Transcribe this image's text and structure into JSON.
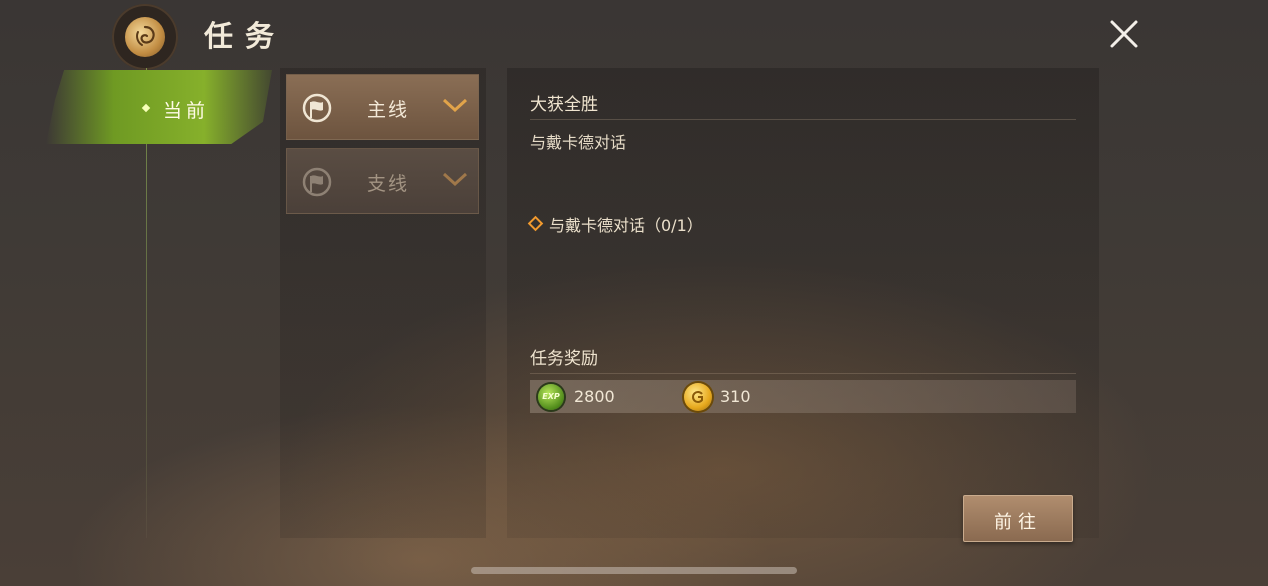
{
  "header": {
    "title": "任务"
  },
  "categories": [
    {
      "label": "当前",
      "active": true
    }
  ],
  "quest_tabs": [
    {
      "label": "主线",
      "active": true
    },
    {
      "label": "支线",
      "active": false
    }
  ],
  "detail": {
    "quest_name": "大获全胜",
    "description": "与戴卡德对话",
    "objective": "与戴卡德对话（0/1）",
    "rewards_title": "任务奖励",
    "rewards": [
      {
        "icon": "exp-icon",
        "icon_text": "EXP",
        "value": "2800"
      },
      {
        "icon": "gold-coin-icon",
        "value": "310"
      }
    ],
    "go_button": "前往"
  },
  "colors": {
    "active_category": "#86b02b",
    "objective_marker": "#f29a2e",
    "accent_gold": "#e2a44a"
  }
}
